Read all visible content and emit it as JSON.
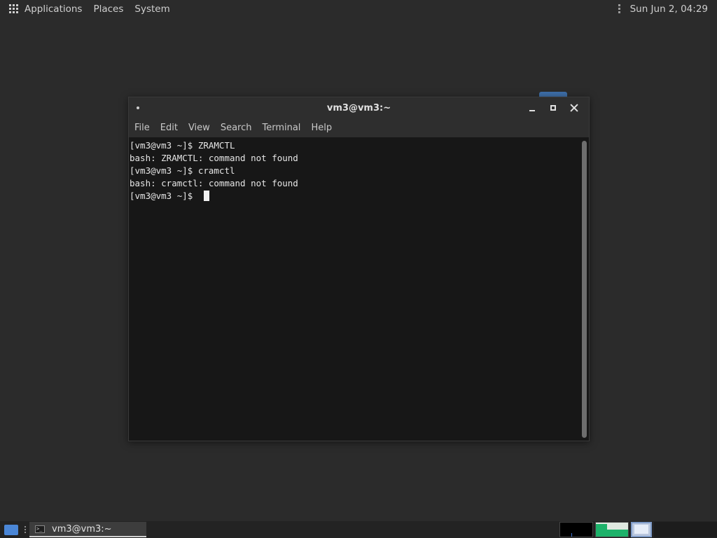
{
  "top_panel": {
    "applications_label": "Applications",
    "places_label": "Places",
    "system_label": "System",
    "clock": "Sun Jun  2, 04:29"
  },
  "window": {
    "title": "vm3@vm3:~",
    "menu": [
      "File",
      "Edit",
      "View",
      "Search",
      "Terminal",
      "Help"
    ]
  },
  "terminal": {
    "lines": [
      "[vm3@vm3 ~]$ ZRAMCTL",
      "bash: ZRAMCTL: command not found",
      "[vm3@vm3 ~]$ cramctl",
      "bash: cramctl: command not found",
      "[vm3@vm3 ~]$ "
    ]
  },
  "taskbar": {
    "task_label": "vm3@vm3:~",
    "task_icon_glyph": ">_"
  },
  "colors": {
    "panel": "#2b2b2b",
    "terminal_bg": "#171717",
    "accent_blue": "#4a86d6",
    "mem_green": "#1db26a"
  }
}
